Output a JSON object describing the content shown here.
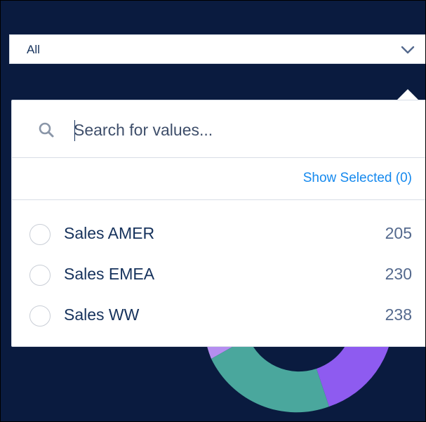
{
  "filter": {
    "selected_value": "All",
    "chevron_icon": "chevron-down-icon"
  },
  "dropdown": {
    "search": {
      "placeholder": "Search for values...",
      "value": "",
      "icon": "search-icon"
    },
    "show_selected_label": "Show Selected (0)",
    "items": [
      {
        "label": "Sales AMER",
        "count": "205",
        "selected": false
      },
      {
        "label": "Sales EMEA",
        "count": "230",
        "selected": false
      },
      {
        "label": "Sales WW",
        "count": "238",
        "selected": false
      }
    ]
  },
  "colors": {
    "background": "#0a1b3f",
    "accent_link": "#1589ee",
    "text_primary": "#16325c",
    "text_secondary": "#54698d",
    "donut_teal": "#4aa79d",
    "donut_purple": "#8e5bf0",
    "donut_lavender": "#b58ef0"
  }
}
